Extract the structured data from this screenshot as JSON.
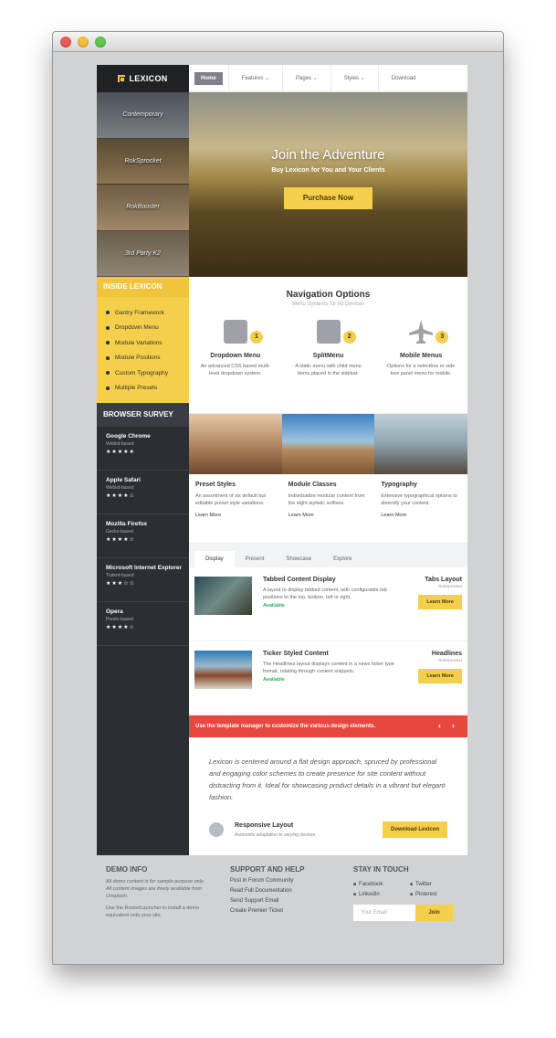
{
  "logo": "LEXICON",
  "thumbs": [
    "Contemporary",
    "RokSprocket",
    "RokBooster",
    "3rd Party K2"
  ],
  "inside": {
    "title": "INSIDE LEXICON",
    "items": [
      "Gantry Framework",
      "Dropdown Menu",
      "Module Variations",
      "Module Positions",
      "Custom Typography",
      "Multiple Presets"
    ]
  },
  "survey": {
    "title": "BROWSER SURVEY",
    "items": [
      {
        "name": "Google Chrome",
        "sub": "Webkit-based",
        "stars": "★★★★★"
      },
      {
        "name": "Apple Safari",
        "sub": "Webkit-based",
        "stars": "★★★★☆"
      },
      {
        "name": "Mozilla Firefox",
        "sub": "Gecko-based",
        "stars": "★★★★☆"
      },
      {
        "name": "Microsoft Internet Explorer",
        "sub": "Trident-based",
        "stars": "★★★☆☆"
      },
      {
        "name": "Opera",
        "sub": "Presto-based",
        "stars": "★★★★☆"
      }
    ]
  },
  "nav": [
    "Home",
    "Features ⌄",
    "Pages ⌄",
    "Styles ⌄",
    "Download"
  ],
  "hero": {
    "title": "Join the Adventure",
    "subtitle": "Buy Lexicon for You and Your Clients",
    "button": "Purchase Now"
  },
  "navopt": {
    "title": "Navigation Options",
    "subtitle": "Menu Systems for All Devices",
    "cols": [
      {
        "num": "1",
        "title": "Dropdown Menu",
        "text": "An advanced CSS based multi-level dropdown system."
      },
      {
        "num": "2",
        "title": "SplitMenu",
        "text": "A static menu with child menu items placed in the sidebar."
      },
      {
        "num": "3",
        "title": "Mobile Menus",
        "text": "Options for a selectbox or side tree panel menu for mobile."
      }
    ]
  },
  "cards": [
    {
      "title": "Preset Styles",
      "text": "An assortment of six default but editable preset style variations.",
      "link": "Learn More"
    },
    {
      "title": "Module Classes",
      "text": "Individualize modular content from the eight stylistic suffixes.",
      "link": "Learn More"
    },
    {
      "title": "Typography",
      "text": "Extensive typographical options to diversify your content.",
      "link": "Learn More"
    }
  ],
  "tabs": [
    "Display",
    "Present",
    "Showcase",
    "Explore"
  ],
  "articles": [
    {
      "title": "Tabbed Content Display",
      "text": "A layout to display tabbed content, with configurable tab positions to the top, bottom, left or right.",
      "status": "Available",
      "rtitle": "Tabs Layout",
      "rsub": "RokSprocket",
      "btn": "Learn More"
    },
    {
      "title": "Ticker Styled Content",
      "text": "The Headlines layout displays content in a news ticker type format, rotating through content snippets.",
      "status": "Available",
      "rtitle": "Headlines",
      "rsub": "RokSprocket",
      "btn": "Learn More"
    }
  ],
  "redbar": {
    "text": "Use the template manager to customize the various design elements.",
    "prev": "‹",
    "next": "›"
  },
  "quote": {
    "text": "Lexicon is centered around a flat design approach, spruced by professional and engaging color schemes to create presence for site content without distracting from it. Ideal for showcasing product details in a vibrant but elegant fashion.",
    "title": "Responsive Layout",
    "sub": "Automatic adaptation to varying devices",
    "btn": "Download Lexicon"
  },
  "footer": {
    "demo": {
      "title": "DEMO INFO",
      "p1": "All demo content is for sample purpose only. All content images are freely available from Unsplash.",
      "p2": "Use the RocketLauncher to install a demo equivalent onto your site."
    },
    "support": {
      "title": "SUPPORT AND HELP",
      "links": [
        "Post in Forum Community",
        "Read Full Documentation",
        "Send Support Email",
        "Create Premier Ticket"
      ]
    },
    "stay": {
      "title": "STAY IN TOUCH",
      "social": [
        "Facebook",
        "Twitter",
        "LinkedIn",
        "Pinterest"
      ],
      "email_placeholder": "Your Email",
      "join": "Join"
    }
  }
}
